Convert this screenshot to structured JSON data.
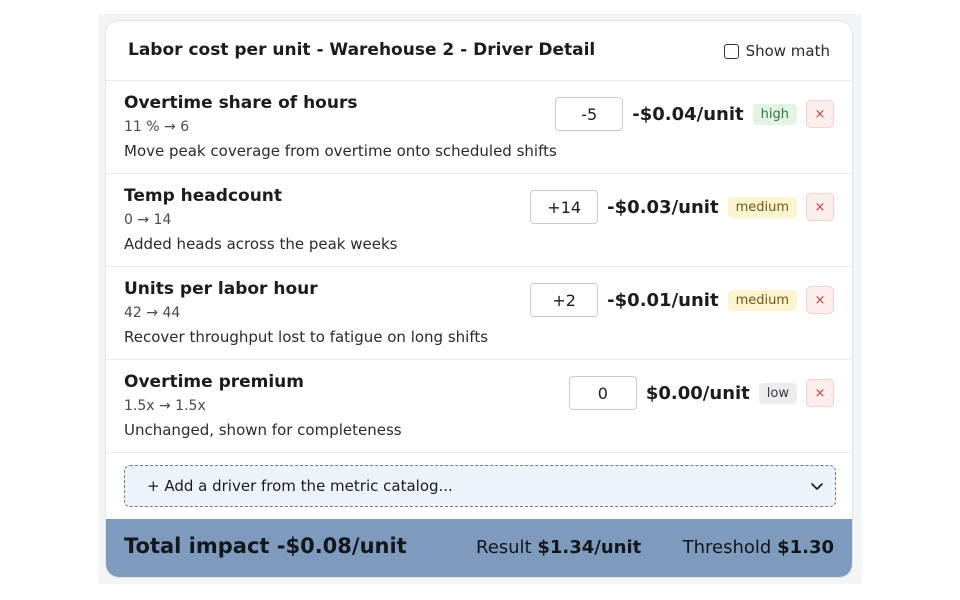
{
  "header": {
    "title": "Labor cost per unit - Warehouse 2 - Driver Detail",
    "show_math_label": "Show math",
    "show_math_checked": false
  },
  "drivers": [
    {
      "name": "Overtime share of hours",
      "change": "11 % → 6",
      "description": "Move peak coverage from overtime onto scheduled shifts",
      "delta": "-5",
      "impact": "-$0.04/unit",
      "confidence": "high",
      "remove_label": "×"
    },
    {
      "name": "Temp headcount",
      "change": "0 → 14",
      "description": "Added heads across the peak weeks",
      "delta": "+14",
      "impact": "-$0.03/unit",
      "confidence": "medium",
      "remove_label": "×"
    },
    {
      "name": "Units per labor hour",
      "change": "42 → 44",
      "description": "Recover throughput lost to fatigue on long shifts",
      "delta": "+2",
      "impact": "-$0.01/unit",
      "confidence": "medium",
      "remove_label": "×"
    },
    {
      "name": "Overtime premium",
      "change": "1.5x → 1.5x",
      "description": "Unchanged, shown for completeness",
      "delta": "0",
      "impact": "$0.00/unit",
      "confidence": "low",
      "remove_label": "×"
    }
  ],
  "add_driver": {
    "label": "+ Add a driver from the metric catalog..."
  },
  "footer": {
    "total_impact": "Total impact -$0.08/unit",
    "result_label": "Result",
    "result_value": "$1.34/unit",
    "threshold_label": "Threshold",
    "threshold_value": "$1.30"
  },
  "colors": {
    "footer_bg": "#7e9bbd",
    "badge_high": "#e3f4e5",
    "badge_medium": "#fdf3cf",
    "badge_low": "#ececee",
    "remove_bg": "#fdeeee",
    "add_driver_bg": "#edf3fb"
  },
  "icons": {
    "remove": "close-icon",
    "add_driver_dropdown": "chevron-down-icon",
    "show_math": "checkbox-icon"
  }
}
